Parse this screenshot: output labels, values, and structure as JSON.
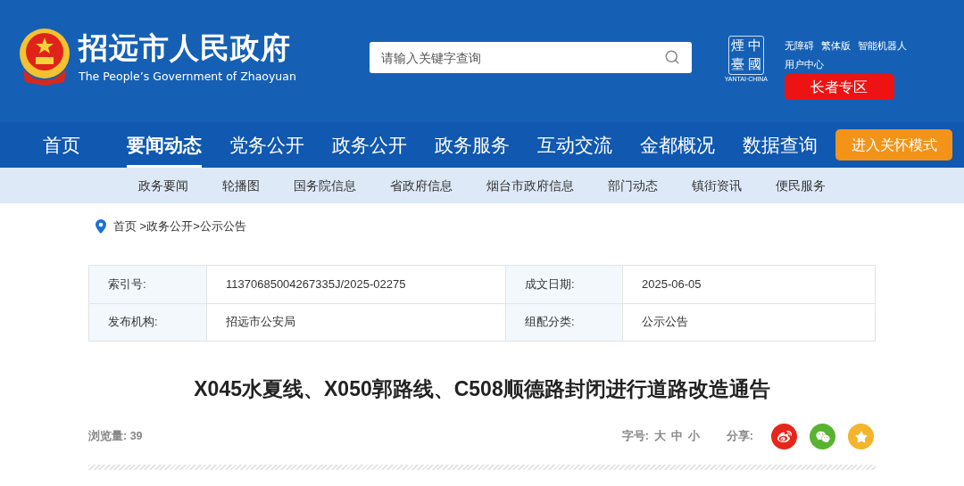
{
  "header": {
    "site_title": "招远市人民政府",
    "site_subtitle": "The People’s Government of Zhaoyuan",
    "search": {
      "placeholder": "请输入关键字查询"
    },
    "seal_logo": {
      "chars": [
        "煙",
        "中",
        "臺",
        "國"
      ],
      "caption": "YANTAI·CHINA"
    },
    "top_links": [
      "无障碍",
      "繁体版",
      "智能机器人"
    ],
    "user_center": "用户中心",
    "elder_button": "长者专区"
  },
  "nav": {
    "items": [
      {
        "label": "首页",
        "selected": false
      },
      {
        "label": "要闻动态",
        "selected": true
      },
      {
        "label": "党务公开",
        "selected": false
      },
      {
        "label": "政务公开",
        "selected": false
      },
      {
        "label": "政务服务",
        "selected": false
      },
      {
        "label": "互动交流",
        "selected": false
      },
      {
        "label": "金都概况",
        "selected": false
      },
      {
        "label": "数据查询",
        "selected": false
      }
    ],
    "care_button": "进入关怀模式"
  },
  "subnav": [
    "政务要闻",
    "轮播图",
    "国务院信息",
    "省政府信息",
    "烟台市政府信息",
    "部门动态",
    "镇街资讯",
    "便民服务"
  ],
  "breadcrumb": "首页 >政务公开>公示公告",
  "meta_table": [
    [
      {
        "label": "索引号:",
        "value": "11370685004267335J/2025-02275"
      },
      {
        "label": "成文日期:",
        "value": "2025-06-05"
      }
    ],
    [
      {
        "label": "发布机构:",
        "value": "招远市公安局"
      },
      {
        "label": "组配分类:",
        "value": "公示公告"
      }
    ]
  ],
  "article": {
    "title": "X045水夏线、X050郭路线、C508顺德路封闭进行道路改造通告",
    "views": "浏览量: 39",
    "font_size_label": "字号:",
    "font_sizes": [
      "大",
      "中",
      "小"
    ],
    "share_label": "分享:",
    "share": [
      {
        "kind": "weibo"
      },
      {
        "kind": "wechat"
      },
      {
        "kind": "qzone"
      }
    ]
  }
}
